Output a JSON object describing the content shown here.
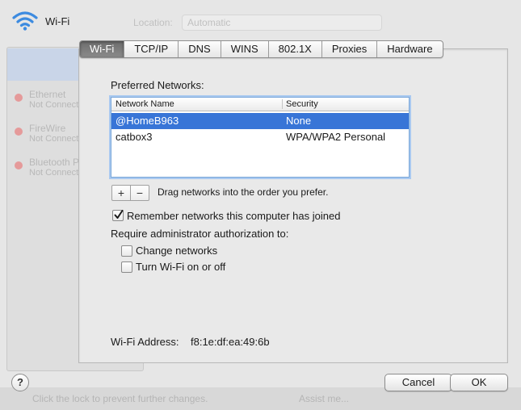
{
  "window": {
    "title": "Wi-Fi"
  },
  "background": {
    "location_label": "Location:",
    "location_value": "Automatic",
    "sidebar": [
      {
        "name": "Ethernet",
        "status": "Not Connected"
      },
      {
        "name": "FireWire",
        "status": "Not Connected"
      },
      {
        "name": "Bluetooth PAN",
        "status": "Not Connected"
      }
    ],
    "lock_text": "Click the lock to prevent further changes.",
    "assist_label": "Assist me..."
  },
  "tabs": [
    {
      "label": "Wi-Fi",
      "active": true
    },
    {
      "label": "TCP/IP",
      "active": false
    },
    {
      "label": "DNS",
      "active": false
    },
    {
      "label": "WINS",
      "active": false
    },
    {
      "label": "802.1X",
      "active": false
    },
    {
      "label": "Proxies",
      "active": false
    },
    {
      "label": "Hardware",
      "active": false
    }
  ],
  "preferred": {
    "heading": "Preferred Networks:",
    "columns": [
      "Network Name",
      "Security"
    ],
    "rows": [
      {
        "name": "@HomeB963",
        "security": "None",
        "selected": true
      },
      {
        "name": "catbox3",
        "security": "WPA/WPA2 Personal",
        "selected": false
      }
    ],
    "add_label": "+",
    "remove_label": "−",
    "hint": "Drag networks into the order you prefer."
  },
  "options": {
    "remember_label": "Remember networks this computer has joined",
    "remember_checked": true,
    "require_heading": "Require administrator authorization to:",
    "change_networks_label": "Change networks",
    "change_networks_checked": false,
    "turn_wifi_label": "Turn Wi-Fi on or off",
    "turn_wifi_checked": false
  },
  "address": {
    "label": "Wi-Fi Address:",
    "value": "f8:1e:df:ea:49:6b"
  },
  "buttons": {
    "help": "?",
    "cancel": "Cancel",
    "ok": "OK"
  },
  "colors": {
    "selection": "#3875d7",
    "active_tab": "#6d6d6d"
  }
}
